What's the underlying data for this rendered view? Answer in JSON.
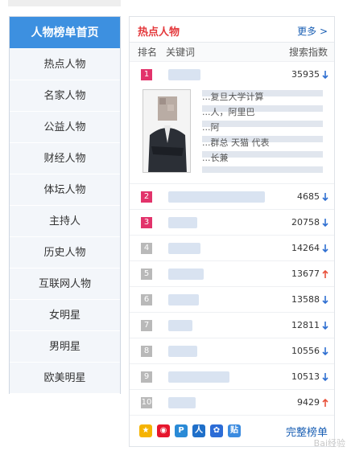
{
  "sidebar": {
    "items": [
      {
        "label": "人物榜单首页",
        "active": true
      },
      {
        "label": "热点人物"
      },
      {
        "label": "名家人物"
      },
      {
        "label": "公益人物"
      },
      {
        "label": "财经人物"
      },
      {
        "label": "体坛人物"
      },
      {
        "label": "主持人"
      },
      {
        "label": "历史人物"
      },
      {
        "label": "互联网人物"
      },
      {
        "label": "女明星"
      },
      {
        "label": "男明星"
      },
      {
        "label": "欧美明星"
      }
    ]
  },
  "panel": {
    "title": "热点人物",
    "more": "更多 >",
    "columns": {
      "rank": "排名",
      "keyword": "关键词",
      "index": "搜索指数"
    },
    "first_desc": [
      "...复旦大学计算",
      "...人，阿里巴",
      "...阿",
      "...群总 天猫 代表",
      "...长兼"
    ],
    "rows": [
      {
        "rank": "1",
        "value": "35935",
        "trend": "down"
      },
      {
        "rank": "2",
        "value": "4685",
        "trend": "down"
      },
      {
        "rank": "3",
        "value": "20758",
        "trend": "down"
      },
      {
        "rank": "4",
        "value": "14264",
        "trend": "down"
      },
      {
        "rank": "5",
        "value": "13677",
        "trend": "up"
      },
      {
        "rank": "6",
        "value": "13588",
        "trend": "down"
      },
      {
        "rank": "7",
        "value": "12811",
        "trend": "down"
      },
      {
        "rank": "8",
        "value": "10556",
        "trend": "down"
      },
      {
        "rank": "9",
        "value": "10513",
        "trend": "down"
      },
      {
        "rank": "10",
        "value": "9429",
        "trend": "up"
      }
    ],
    "full_list": "完整榜单",
    "share_icons": [
      "qzone-icon",
      "weibo-icon",
      "paopao-icon",
      "renren-icon",
      "baidu-icon",
      "tieba-icon"
    ]
  },
  "colors": {
    "accent": "#3d90e0",
    "top_rank": "#e2336b",
    "down": "#2f6fd1",
    "up": "#e8513b"
  },
  "watermark": "Bai经验"
}
